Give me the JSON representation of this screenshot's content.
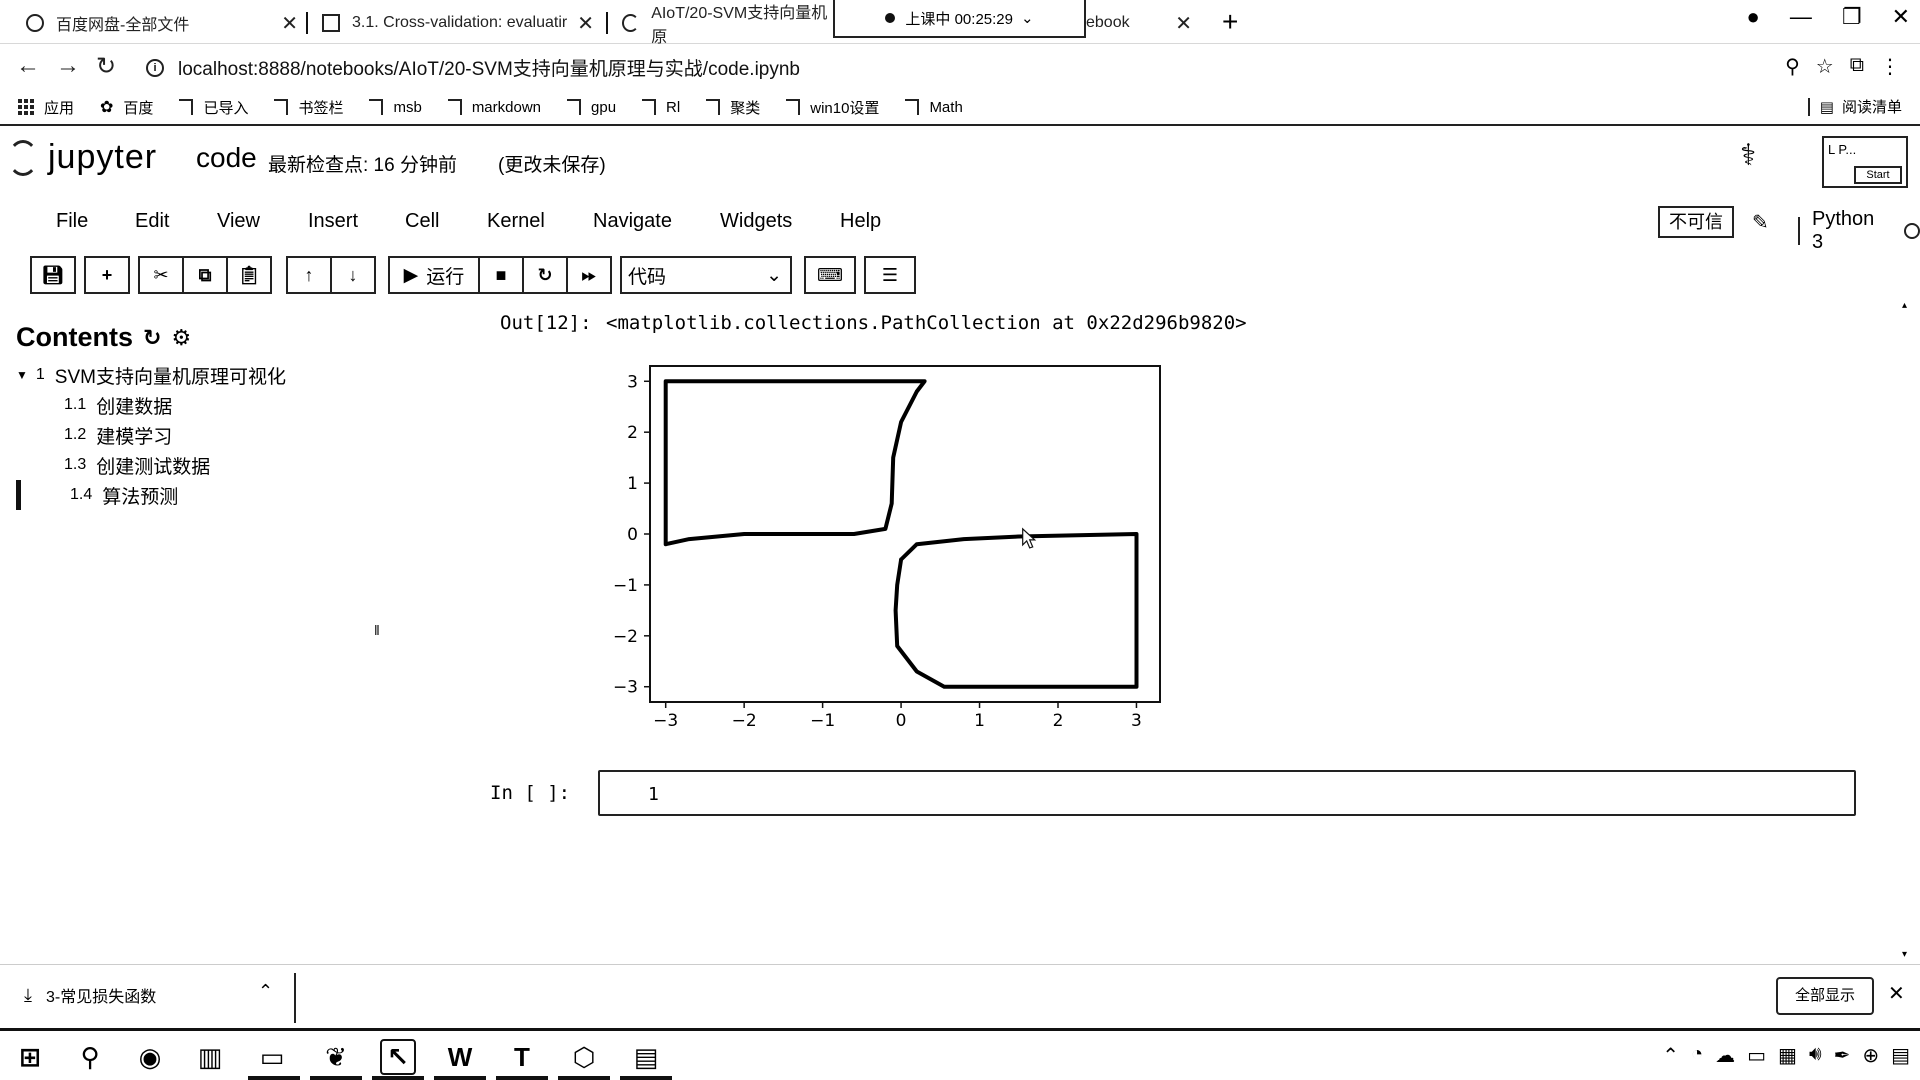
{
  "tabs": [
    {
      "title": "百度网盘-全部文件"
    },
    {
      "title": "3.1. Cross-validation: evaluatir"
    },
    {
      "title": "AIoT/20-SVM支持向量机原"
    },
    {
      "title": "ebook"
    }
  ],
  "recording": {
    "label": "上课中 00:25:29",
    "chevron": "⌄"
  },
  "address": {
    "url": "localhost:8888/notebooks/AIoT/20-SVM支持向量机原理与实战/code.ipynb"
  },
  "bookmarks": [
    {
      "label": "应用",
      "icon": "apps-grid-icon"
    },
    {
      "label": "百度",
      "icon": "baidu-paw-icon"
    },
    {
      "label": "已导入",
      "icon": "folder-icon"
    },
    {
      "label": "书签栏",
      "icon": "folder-icon"
    },
    {
      "label": "msb",
      "icon": "folder-icon"
    },
    {
      "label": "markdown",
      "icon": "folder-icon"
    },
    {
      "label": "gpu",
      "icon": "folder-icon"
    },
    {
      "label": "Rl",
      "icon": "folder-icon"
    },
    {
      "label": "聚类",
      "icon": "folder-icon"
    },
    {
      "label": "win10设置",
      "icon": "folder-icon"
    },
    {
      "label": "Math",
      "icon": "folder-icon"
    }
  ],
  "reading_list": "阅读清单",
  "jupyter": {
    "logo_text": "jupyter",
    "notebook_name": "code",
    "checkpoint": "最新检查点: 16 分钟前",
    "unsaved": "(更改未保存)",
    "start_box": {
      "label": "L P...",
      "button": "Start"
    }
  },
  "menu": [
    "File",
    "Edit",
    "View",
    "Insert",
    "Cell",
    "Kernel",
    "Navigate",
    "Widgets",
    "Help"
  ],
  "trust_label": "不可信",
  "kernel_name": "Python 3",
  "toolbar": {
    "run_label": "运行",
    "cell_type": "代码"
  },
  "toc": {
    "title": "Contents",
    "items": [
      {
        "num": "1",
        "label": "SVM支持向量机原理可视化",
        "level": 1
      },
      {
        "num": "1.1",
        "label": "创建数据",
        "level": 2
      },
      {
        "num": "1.2",
        "label": "建模学习",
        "level": 2
      },
      {
        "num": "1.3",
        "label": "创建测试数据",
        "level": 2
      },
      {
        "num": "1.4",
        "label": "算法预测",
        "level": 2,
        "active": true
      }
    ]
  },
  "output": {
    "prompt": "Out[12]:",
    "text": "<matplotlib.collections.PathCollection at 0x22d296b9820>"
  },
  "input_cell": {
    "prompt": "In  [  ]:",
    "line_number": "1"
  },
  "chart_data": {
    "type": "scatter",
    "title": "",
    "xlabel": "",
    "ylabel": "",
    "xlim": [
      -3.2,
      3.3
    ],
    "ylim": [
      -3.3,
      3.3
    ],
    "xticks": [
      "−3",
      "−2",
      "−1",
      "0",
      "1",
      "2",
      "3"
    ],
    "yticks": [
      "3",
      "2",
      "1",
      "0",
      "−1",
      "−2",
      "−3"
    ],
    "xtick_values": [
      -3,
      -2,
      -1,
      0,
      1,
      2,
      3
    ],
    "ytick_values": [
      3,
      2,
      1,
      0,
      -1,
      -2,
      -3
    ],
    "series": [
      {
        "color": "#000000",
        "points": [
          [
            -3,
            -0.2
          ],
          [
            -3,
            3
          ],
          [
            0.3,
            3
          ],
          [
            0.2,
            2.8
          ],
          [
            0,
            2.2
          ],
          [
            -0.1,
            1.5
          ],
          [
            -0.12,
            0.6
          ],
          [
            -0.2,
            0.1
          ],
          [
            -0.6,
            0
          ],
          [
            -2,
            0
          ],
          [
            -2.7,
            -0.1
          ],
          [
            -3,
            -0.2
          ]
        ]
      },
      {
        "color": "#000000",
        "points": [
          [
            0,
            -0.5
          ],
          [
            0.2,
            -0.2
          ],
          [
            0.8,
            -0.1
          ],
          [
            1.5,
            -0.05
          ],
          [
            3,
            0
          ],
          [
            3,
            -3
          ],
          [
            0.55,
            -3
          ],
          [
            0.2,
            -2.7
          ],
          [
            -0.05,
            -2.2
          ],
          [
            -0.07,
            -1.5
          ],
          [
            -0.05,
            -1
          ],
          [
            0,
            -0.5
          ]
        ]
      }
    ]
  },
  "downloads": {
    "item": "3-常见损失函数",
    "show_all": "全部显示"
  }
}
